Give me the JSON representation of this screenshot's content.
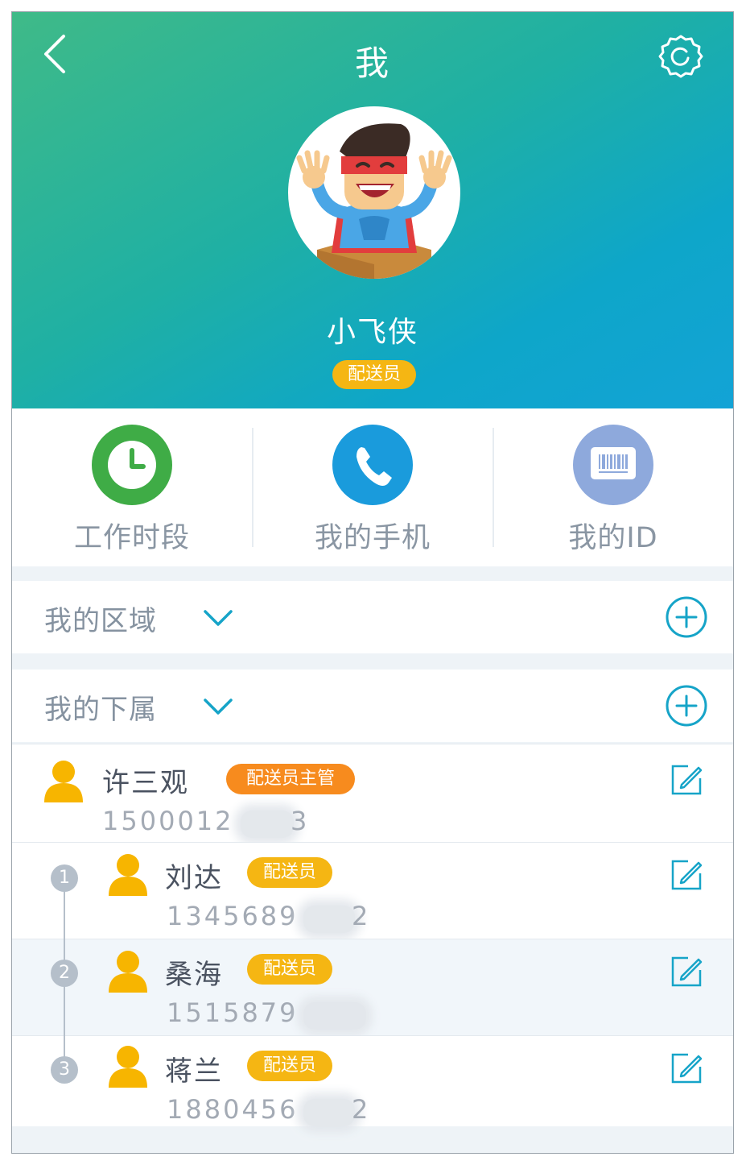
{
  "header": {
    "title": "我",
    "back_icon": "chevron-left-icon",
    "settings_icon": "gear-icon",
    "username": "小飞侠",
    "role": "配送员",
    "colors": {
      "gradient_start": "#3fba88",
      "gradient_end": "#13a3d6"
    }
  },
  "actions": [
    {
      "label": "工作时段",
      "icon": "clock-icon",
      "color": "#3fac46"
    },
    {
      "label": "我的手机",
      "icon": "phone-icon",
      "color": "#1a9bdc"
    },
    {
      "label": "我的ID",
      "icon": "barcode-icon",
      "color": "#8ea9dc"
    }
  ],
  "sections": {
    "region": {
      "title": "我的区域",
      "expand_icon": "chevron-down-icon",
      "add_icon": "plus-circle-icon"
    },
    "subordinates": {
      "title": "我的下属",
      "expand_icon": "chevron-down-icon",
      "add_icon": "plus-circle-icon"
    }
  },
  "supervisor": {
    "name": "许三观",
    "badge": "配送员主管",
    "phone": "1500012",
    "phone_tail": "3"
  },
  "subordinates": [
    {
      "index": "1",
      "name": "刘达",
      "badge": "配送员",
      "phone": "1345689",
      "phone_tail": "2"
    },
    {
      "index": "2",
      "name": "桑海",
      "badge": "配送员",
      "phone": "1515879",
      "phone_tail": ""
    },
    {
      "index": "3",
      "name": "蒋兰",
      "badge": "配送员",
      "phone": "1880456",
      "phone_tail": "2"
    }
  ],
  "colors": {
    "accent": "#16a4c8",
    "badge_orange": "#f78b1e",
    "badge_yellow": "#f5b613",
    "person_yellow": "#f7b500"
  }
}
